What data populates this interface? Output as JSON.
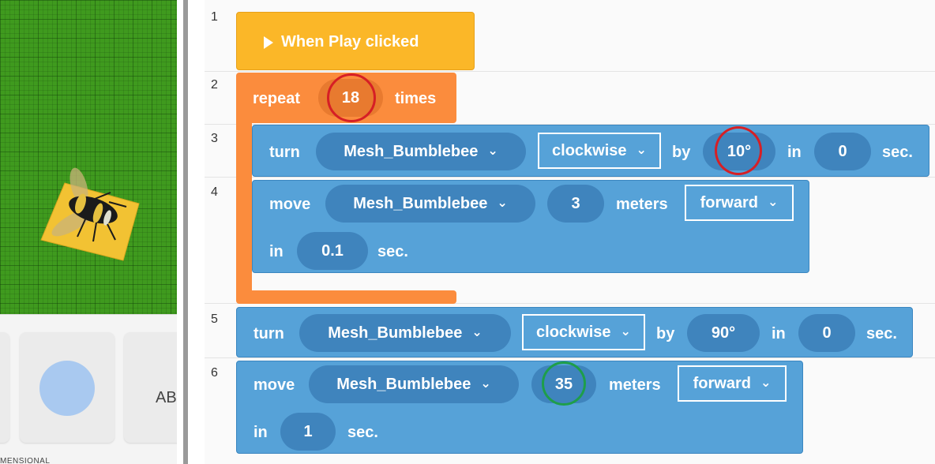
{
  "scene": {
    "asset_label_partial": "MENSIONAL",
    "asset_text_partial": "AB"
  },
  "editor": {
    "line_numbers": [
      "1",
      "2",
      "3",
      "4",
      "5",
      "6"
    ],
    "event": {
      "label": "When Play clicked",
      "icon": "play-icon"
    },
    "repeat": {
      "keyword": "repeat",
      "count": "18",
      "suffix": "times"
    },
    "turn1": {
      "keyword": "turn",
      "object": "Mesh_Bumblebee",
      "direction": "clockwise",
      "by": "by",
      "angle": "10°",
      "in": "in",
      "duration": "0",
      "unit": "sec."
    },
    "move1": {
      "keyword": "move",
      "object": "Mesh_Bumblebee",
      "distance": "3",
      "meters": "meters",
      "direction": "forward",
      "in": "in",
      "duration": "0.1",
      "unit": "sec."
    },
    "turn2": {
      "keyword": "turn",
      "object": "Mesh_Bumblebee",
      "direction": "clockwise",
      "by": "by",
      "angle": "90°",
      "in": "in",
      "duration": "0",
      "unit": "sec."
    },
    "move2": {
      "keyword": "move",
      "object": "Mesh_Bumblebee",
      "distance": "35",
      "meters": "meters",
      "direction": "forward",
      "in": "in",
      "duration": "1",
      "unit": "sec."
    }
  },
  "colors": {
    "event_block": "#fbb728",
    "control_block": "#fb8c3d",
    "motion_block": "#56a2d8",
    "highlight_red": "#d61f25",
    "highlight_green": "#1e9e4a"
  }
}
